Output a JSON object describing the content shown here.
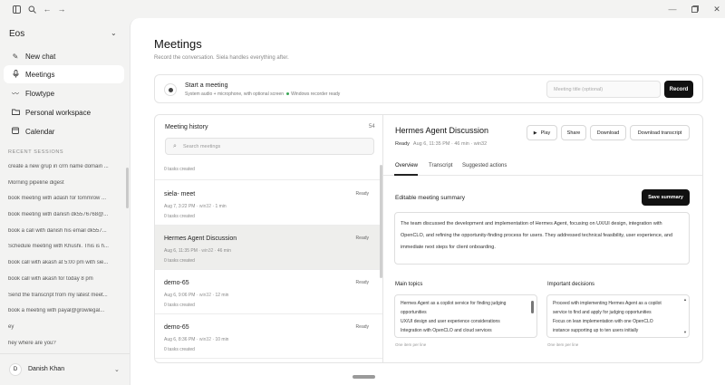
{
  "sidebar": {
    "workspace": "Eos",
    "nav": [
      {
        "label": "New chat",
        "icon": "new-chat-icon"
      },
      {
        "label": "Meetings",
        "icon": "microphone-icon"
      },
      {
        "label": "Flowtype",
        "icon": "flow-icon"
      },
      {
        "label": "Personal workspace",
        "icon": "folder-icon"
      },
      {
        "label": "Calendar",
        "icon": "calendar-icon"
      }
    ],
    "recent_heading": "RECENT SESSIONS",
    "sessions": [
      "create a new grup in crm name domain ...",
      "Morning pipeline digest",
      "book meeting with adash for tommrow ...",
      "book meeting with danish dk5576768@...",
      "book a call with danish his email dk557...",
      "Schedule meeting with Khushi. This is h...",
      "book call with akash at 5:00 pm with sie...",
      "book call with akash for today 8 pm",
      "Send the transcript from my latest meet...",
      "book a meeting with payal@growlegal...",
      "ey",
      "hey where are you?"
    ],
    "user": {
      "initial": "D",
      "name": "Danish Khan"
    }
  },
  "page": {
    "title": "Meetings",
    "subtitle": "Record the conversation. Siela handles everything after."
  },
  "start": {
    "title": "Start a meeting",
    "desc": "System audio + microphone, with optional screen",
    "status": "Windows recorder ready",
    "placeholder": "Meeting title (optional)",
    "record": "Record"
  },
  "history": {
    "title": "Meeting history",
    "count": "54",
    "search_placeholder": "Search meetings",
    "top_tasks": "0 tasks created",
    "items": [
      {
        "title": "siela- meet",
        "status": "Ready",
        "date": "Aug 7, 3:22 PM",
        "platform": "win32",
        "duration": "1 min",
        "tasks": "0 tasks created"
      },
      {
        "title": "Hermes Agent Discussion",
        "status": "Ready",
        "date": "Aug 6, 11:35 PM",
        "platform": "win32",
        "duration": "46 min",
        "tasks": "0 tasks created"
      },
      {
        "title": "demo-65",
        "status": "Ready",
        "date": "Aug 6, 9:06 PM",
        "platform": "win32",
        "duration": "12 min",
        "tasks": "0 tasks created"
      },
      {
        "title": "demo-65",
        "status": "Ready",
        "date": "Aug 6, 8:36 PM",
        "platform": "win32",
        "duration": "10 min",
        "tasks": "0 tasks created"
      }
    ]
  },
  "detail": {
    "title": "Hermes Agent Discussion",
    "status": "Ready",
    "meta": "Aug 6, 11:35 PM · 46 min · win32",
    "buttons": {
      "play": "Play",
      "share": "Share",
      "download": "Download",
      "download_transcript": "Download transcript"
    },
    "tabs": [
      "Overview",
      "Transcript",
      "Suggested actions"
    ],
    "editable_label": "Editable meeting summary",
    "save": "Save summary",
    "summary": "The team discussed the development and implementation of Hermes Agent, focusing on UX/UI design, integration with OpenCLO, and refining the opportunity-finding process for users. They addressed technical feasibility, user experience, and immediate next steps for client onboarding.",
    "main_topics_label": "Main topics",
    "main_topics": [
      "Hermes Agent as a copilot service for finding judging",
      "opportunities",
      "UX/UI design and user experience considerations",
      "Integration with OpenCLO and cloud services"
    ],
    "decisions_label": "Important decisions",
    "decisions": [
      "Proceed with implementing Hermes Agent as a copilot",
      "service to find and apply for judging opportunities",
      "Focus on lean implementation with one OpenCLO",
      "instance supporting up to ten users initially"
    ],
    "hint": "One item per line"
  }
}
